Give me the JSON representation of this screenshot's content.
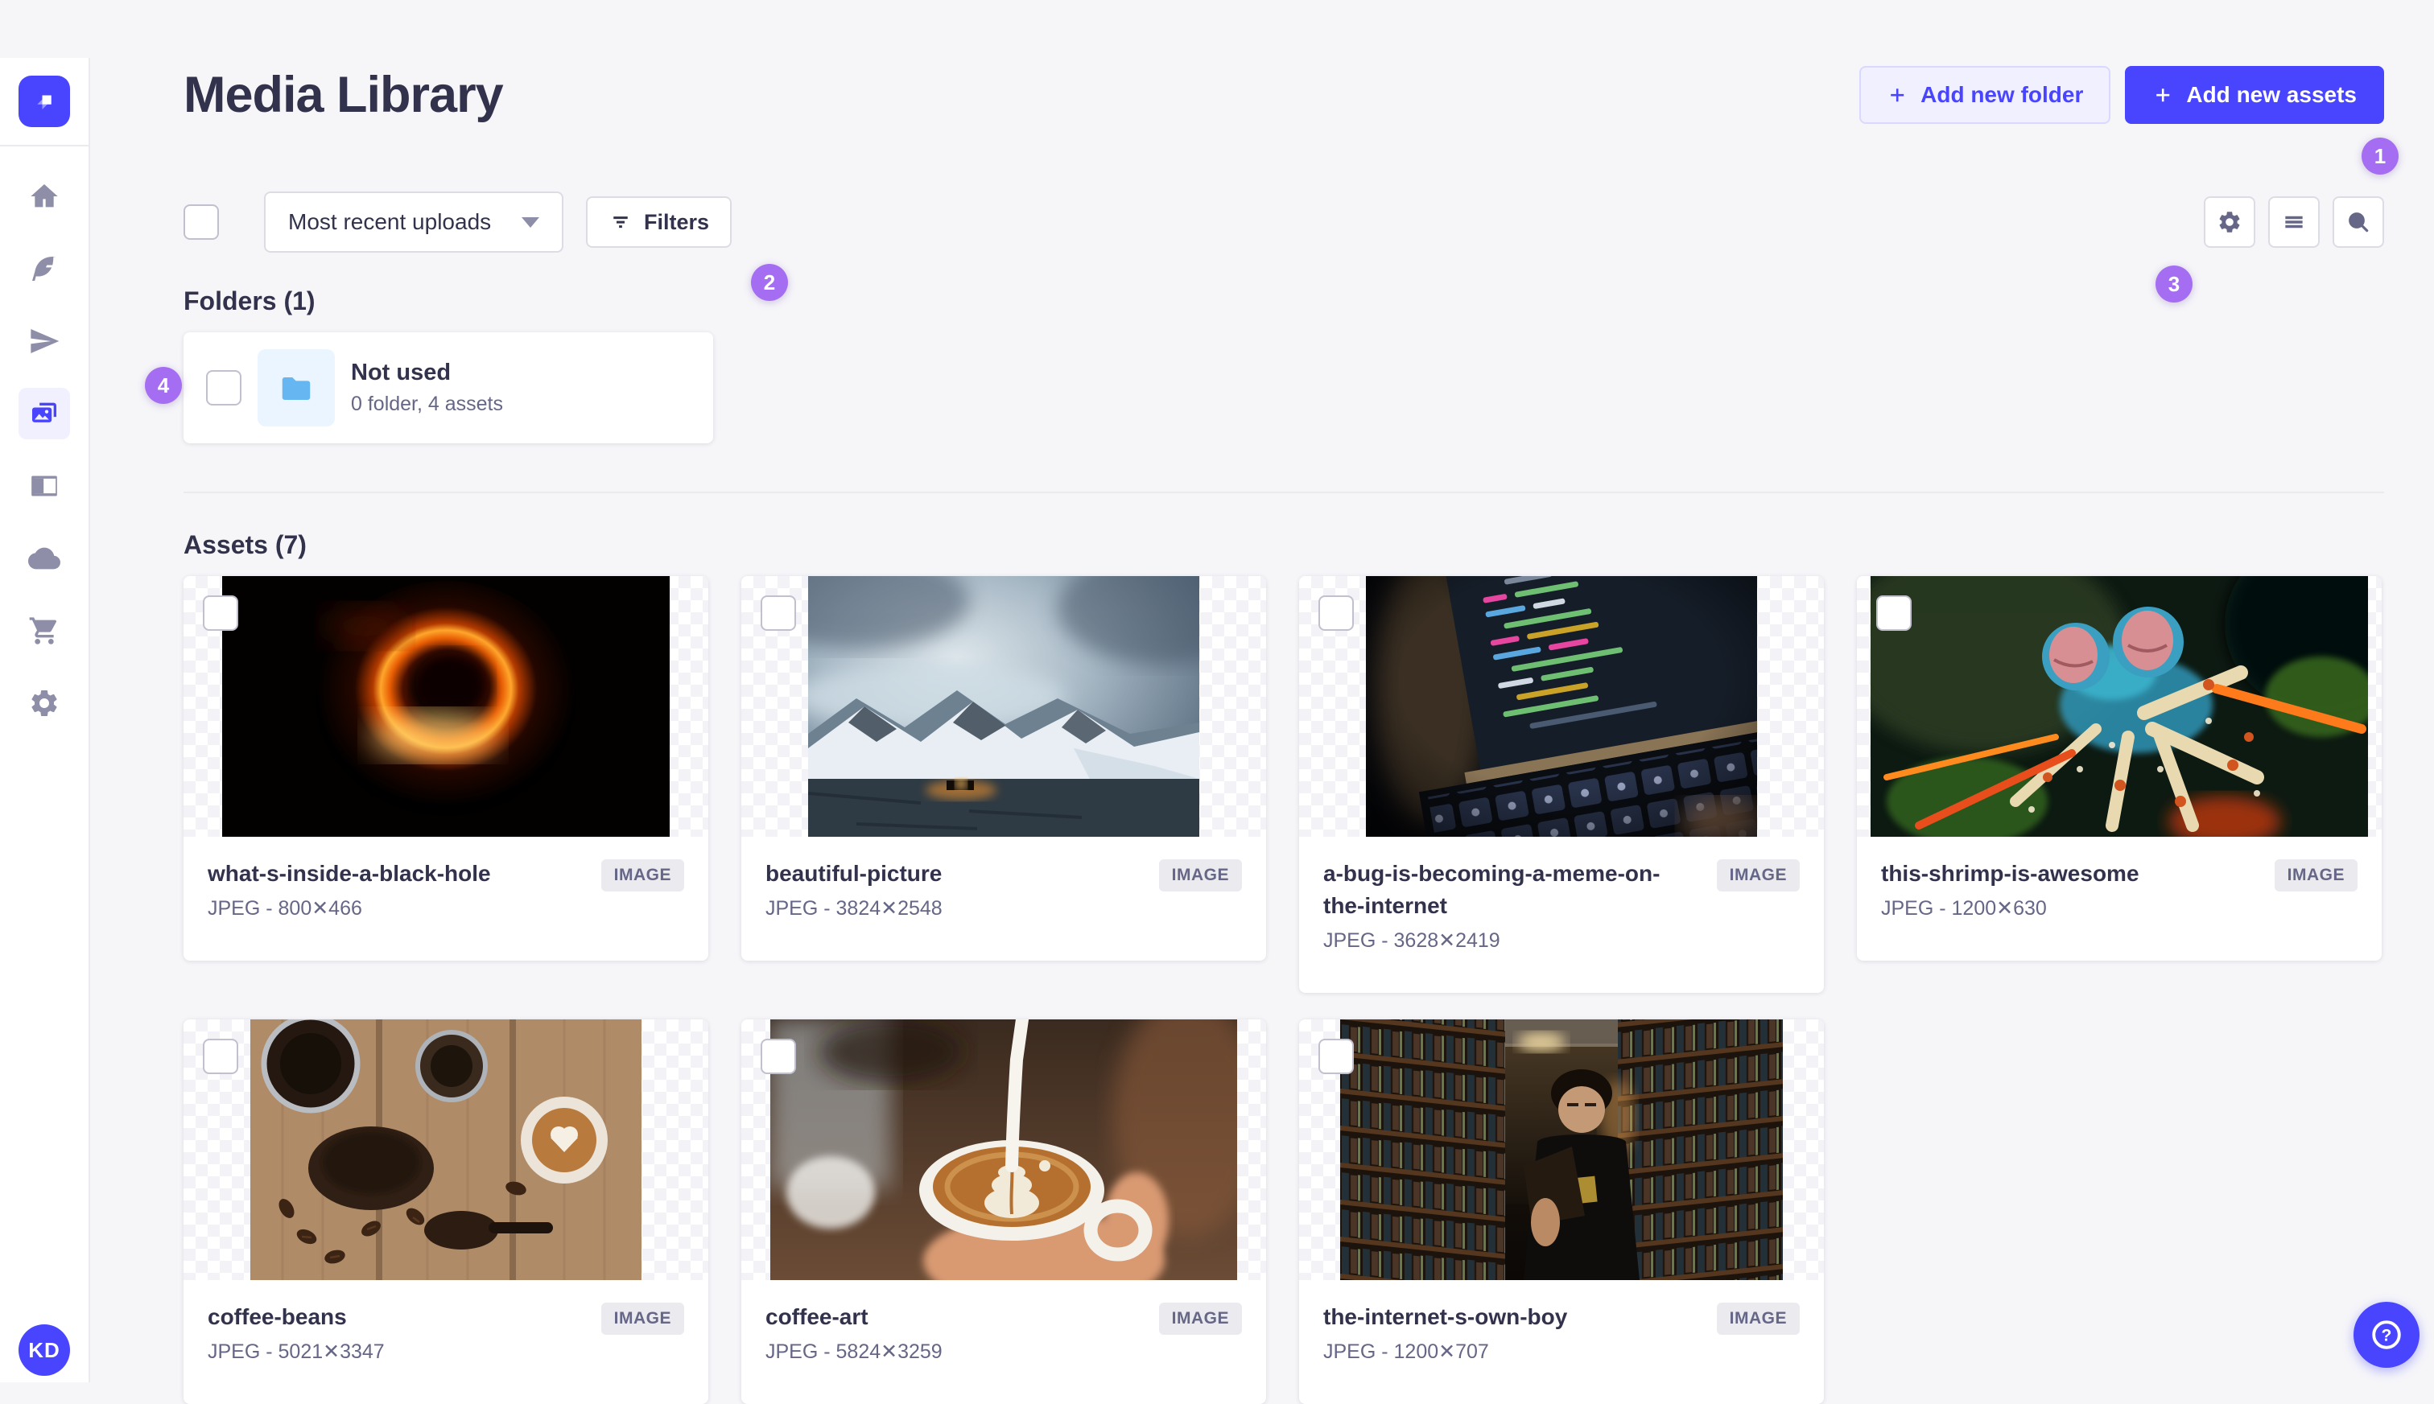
{
  "header": {
    "title": "Media Library",
    "add_folder_label": "Add new folder",
    "add_assets_label": "Add new assets"
  },
  "toolbar": {
    "sort_value": "Most recent uploads",
    "filters_label": "Filters"
  },
  "annotations": {
    "a1": "1",
    "a2": "2",
    "a3": "3",
    "a4": "4",
    "color": "#a56ef2"
  },
  "folders": {
    "title": "Folders (1)",
    "items": [
      {
        "name": "Not used",
        "meta": "0 folder, 4 assets"
      }
    ]
  },
  "assets": {
    "title": "Assets (7)",
    "items": [
      {
        "name": "what-s-inside-a-black-hole",
        "meta": "JPEG - 800✕466",
        "badge": "IMAGE",
        "thumb": "black-hole"
      },
      {
        "name": "beautiful-picture",
        "meta": "JPEG - 3824✕2548",
        "badge": "IMAGE",
        "thumb": "snowy-mountains"
      },
      {
        "name": "a-bug-is-becoming-a-meme-on-the-internet",
        "meta": "JPEG - 3628✕2419",
        "badge": "IMAGE",
        "thumb": "laptop-code"
      },
      {
        "name": "this-shrimp-is-awesome",
        "meta": "JPEG - 1200✕630",
        "badge": "IMAGE",
        "thumb": "mantis-shrimp"
      },
      {
        "name": "coffee-beans",
        "meta": "JPEG - 5021✕3347",
        "badge": "IMAGE",
        "thumb": "coffee-beans"
      },
      {
        "name": "coffee-art",
        "meta": "JPEG - 5824✕3259",
        "badge": "IMAGE",
        "thumb": "latte-art"
      },
      {
        "name": "the-internet-s-own-boy",
        "meta": "JPEG - 1200✕707",
        "badge": "IMAGE",
        "thumb": "library-portrait"
      }
    ]
  },
  "sidebar": {
    "logo_icon": "strapi-logo",
    "items": [
      {
        "icon": "home-icon",
        "active": false
      },
      {
        "icon": "feather-icon",
        "active": false
      },
      {
        "icon": "paper-plane-icon",
        "active": false
      },
      {
        "icon": "media-library-icon",
        "active": true
      },
      {
        "icon": "layout-icon",
        "active": false
      },
      {
        "icon": "cloud-icon",
        "active": false
      },
      {
        "icon": "cart-icon",
        "active": false
      },
      {
        "icon": "gear-icon",
        "active": false
      }
    ],
    "avatar_initials": "KD"
  },
  "view_controls": {
    "icons": [
      "gear-icon",
      "list-icon",
      "search-icon"
    ]
  },
  "help": {
    "label": "?"
  },
  "colors": {
    "primary": "#4945ff",
    "annotation": "#a56ef2",
    "folder_blue": "#66b7f1"
  }
}
